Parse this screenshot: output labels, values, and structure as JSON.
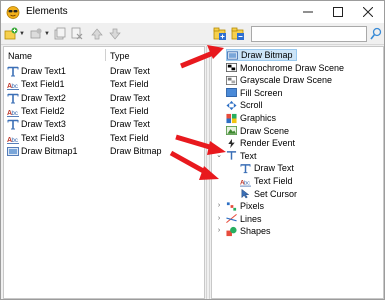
{
  "window": {
    "title": "Elements"
  },
  "toolbar": {
    "search_value": ""
  },
  "list": {
    "headers": [
      "Name",
      "Type"
    ],
    "rows": [
      {
        "name": "Draw Text1",
        "type": "Draw Text",
        "icon": "draw-text-icon"
      },
      {
        "name": "Text Field1",
        "type": "Text Field",
        "icon": "text-field-icon"
      },
      {
        "name": "Draw Text2",
        "type": "Draw Text",
        "icon": "draw-text-icon"
      },
      {
        "name": "Text Field2",
        "type": "Text Field",
        "icon": "text-field-icon"
      },
      {
        "name": "Draw Text3",
        "type": "Draw Text",
        "icon": "draw-text-icon"
      },
      {
        "name": "Text Field3",
        "type": "Text Field",
        "icon": "text-field-icon"
      },
      {
        "name": "Draw Bitmap1",
        "type": "Draw Bitmap",
        "icon": "draw-bitmap-icon"
      }
    ]
  },
  "tree": {
    "items": [
      {
        "label": "Draw Bitmap",
        "icon": "draw-bitmap-icon",
        "selected": true
      },
      {
        "label": "Monochrome Draw Scene",
        "icon": "monochrome-scene-icon"
      },
      {
        "label": "Grayscale Draw Scene",
        "icon": "grayscale-scene-icon"
      },
      {
        "label": "Fill Screen",
        "icon": "fill-screen-icon"
      },
      {
        "label": "Scroll",
        "icon": "scroll-icon"
      },
      {
        "label": "Graphics",
        "icon": "graphics-icon"
      },
      {
        "label": "Draw Scene",
        "icon": "draw-scene-icon"
      },
      {
        "label": "Render Event",
        "icon": "render-event-icon"
      },
      {
        "label": "Text",
        "icon": "text-group-icon",
        "expanded": true
      },
      {
        "label": "Draw Text",
        "icon": "draw-text-icon"
      },
      {
        "label": "Text Field",
        "icon": "text-field-icon"
      },
      {
        "label": "Set Cursor",
        "icon": "set-cursor-icon"
      },
      {
        "label": "Pixels",
        "icon": "pixels-icon",
        "collapsed": true
      },
      {
        "label": "Lines",
        "icon": "lines-icon",
        "collapsed": true
      },
      {
        "label": "Shapes",
        "icon": "shapes-icon",
        "collapsed": true
      }
    ]
  },
  "colors": {
    "selection": "#cce4f7",
    "annotation_arrow": "#e8191e"
  }
}
